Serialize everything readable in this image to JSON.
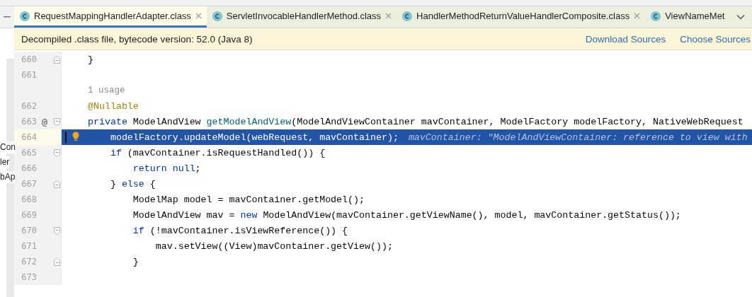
{
  "editor_tabs": [
    {
      "label": "RequestMappingHandlerAdapter.class",
      "selected": true,
      "closable": true
    },
    {
      "label": "ServletInvocableHandlerMethod.class",
      "selected": false,
      "closable": true
    },
    {
      "label": "HandlerMethodReturnValueHandlerComposite.class",
      "selected": false,
      "closable": true
    },
    {
      "label": "ViewNameMet",
      "selected": false,
      "closable": false
    }
  ],
  "banner": {
    "message": "Decompiled .class file, bytecode version: 52.0 (Java 8)",
    "links": [
      "Download Sources",
      "Choose Sources"
    ]
  },
  "side_panel": {
    "items": [
      "Con",
      "ler",
      "bAp"
    ]
  },
  "code_lines": [
    {
      "kind": "code",
      "number": "660",
      "fold_start": false,
      "fold_end": true,
      "selected": false,
      "tokens": [
        {
          "kind": "plain",
          "text": "}"
        }
      ]
    },
    {
      "kind": "code",
      "number": "661",
      "fold_start": false,
      "fold_end": false,
      "selected": false
    },
    {
      "kind": "usage",
      "text": "1 usage"
    },
    {
      "kind": "code",
      "number": "662",
      "fold_start": false,
      "fold_end": false,
      "selected": false,
      "tokens": [
        {
          "kind": "ann",
          "text": "@Nullable"
        }
      ]
    },
    {
      "kind": "code",
      "number": "663",
      "mark": "@",
      "fold_start": true,
      "fold_end": false,
      "selected": false,
      "tokens": [
        {
          "kind": "kw",
          "text": "private "
        },
        {
          "kind": "plain",
          "text": "ModelAndView "
        },
        {
          "kind": "fn",
          "text": "getModelAndView"
        },
        {
          "kind": "plain",
          "text": "(ModelAndViewContainer mavContainer, ModelFactory modelFactory, NativeWebRequest"
        }
      ]
    },
    {
      "kind": "code",
      "number": "664",
      "fold_start": false,
      "fold_end": false,
      "selected": true,
      "tokens": [
        {
          "kind": "plain",
          "text": "    modelFactory.updateModel(webRequest, mavContainer);"
        }
      ],
      "hint": "mavContainer: \"ModelAndViewContainer: reference to view with"
    },
    {
      "kind": "code",
      "number": "665",
      "fold_start": true,
      "fold_end": false,
      "selected": false,
      "tokens": [
        {
          "kind": "kw",
          "text": "    if "
        },
        {
          "kind": "plain",
          "text": "(mavContainer.isRequestHandled()) {"
        }
      ]
    },
    {
      "kind": "code",
      "number": "666",
      "fold_start": false,
      "fold_end": false,
      "selected": false,
      "tokens": [
        {
          "kind": "kw",
          "text": "        return null"
        },
        {
          "kind": "plain",
          "text": ";"
        }
      ]
    },
    {
      "kind": "code",
      "number": "667",
      "fold_start": false,
      "fold_end": true,
      "selected": false,
      "tokens": [
        {
          "kind": "plain",
          "text": "    } "
        },
        {
          "kind": "kw",
          "text": "else "
        },
        {
          "kind": "plain",
          "text": "{"
        }
      ]
    },
    {
      "kind": "code",
      "number": "668",
      "fold_start": false,
      "fold_end": false,
      "selected": false,
      "tokens": [
        {
          "kind": "plain",
          "text": "        ModelMap model = mavContainer.getModel();"
        }
      ]
    },
    {
      "kind": "code",
      "number": "669",
      "fold_start": false,
      "fold_end": false,
      "selected": false,
      "tokens": [
        {
          "kind": "plain",
          "text": "        ModelAndView mav = "
        },
        {
          "kind": "kw",
          "text": "new "
        },
        {
          "kind": "plain",
          "text": "ModelAndView(mavContainer.getViewName(), model, mavContainer.getStatus());"
        }
      ]
    },
    {
      "kind": "code",
      "number": "670",
      "fold_start": true,
      "fold_end": false,
      "selected": false,
      "tokens": [
        {
          "kind": "kw",
          "text": "        if "
        },
        {
          "kind": "plain",
          "text": "(!mavContainer.isViewReference()) {"
        }
      ]
    },
    {
      "kind": "code",
      "number": "671",
      "fold_start": false,
      "fold_end": false,
      "selected": false,
      "tokens": [
        {
          "kind": "plain",
          "text": "            mav.setView((View)mavContainer.getView());"
        }
      ]
    },
    {
      "kind": "code",
      "number": "672",
      "fold_start": false,
      "fold_end": true,
      "selected": false,
      "tokens": [
        {
          "kind": "plain",
          "text": "        }"
        }
      ]
    },
    {
      "kind": "code",
      "number": "673",
      "fold_start": false,
      "fold_end": false,
      "selected": false
    }
  ]
}
